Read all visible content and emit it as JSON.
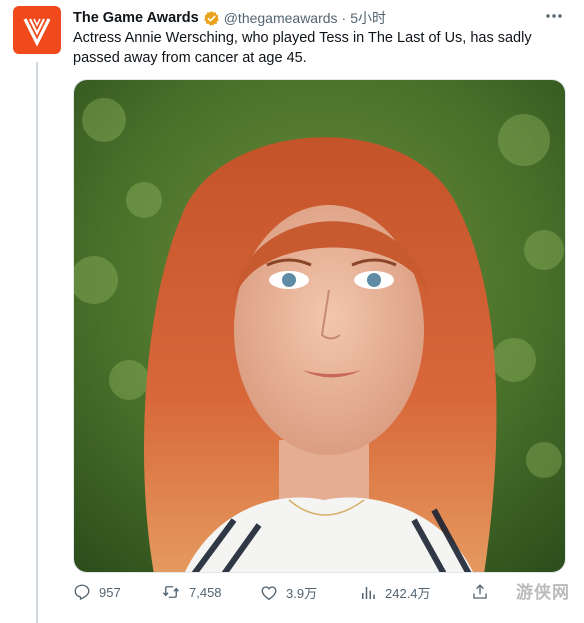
{
  "account": {
    "name": "The Game Awards",
    "handle": "@thegameawards",
    "separator": "·",
    "time": "5小时",
    "avatar_color": "#f04a1c",
    "verified_color": "#e8a31a"
  },
  "tweet": {
    "text": "Actress Annie Wersching, who played Tess in The Last of Us, has sadly passed away from cancer at age 45.",
    "media": {
      "subject": "portrait",
      "icon": "photo"
    }
  },
  "actions": {
    "reply_count": "957",
    "retweet_count": "7,458",
    "like_count": "3.9万",
    "views_count": "242.4万"
  },
  "more_icon": "more-dots-icon",
  "watermark": "游侠网"
}
